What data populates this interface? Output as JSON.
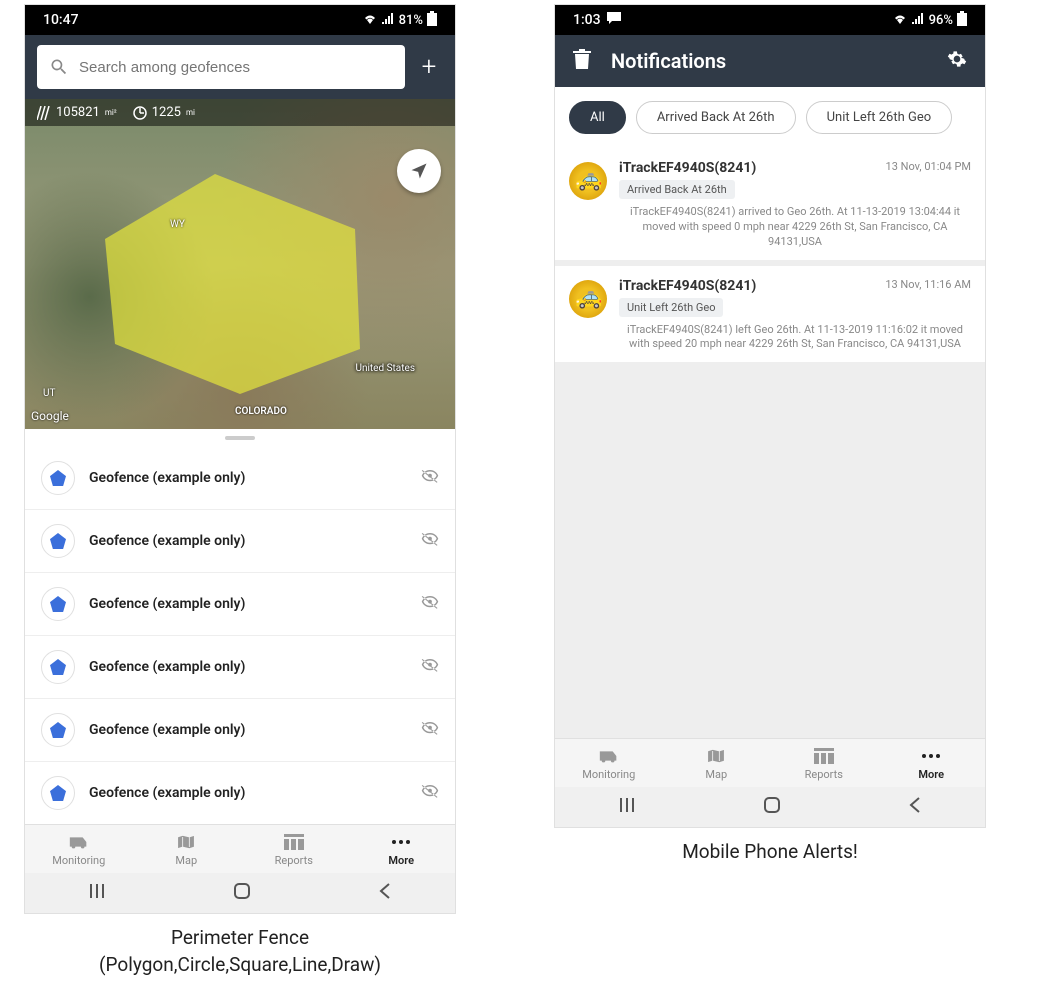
{
  "phone1": {
    "status": {
      "time": "10:47",
      "battery": "81%"
    },
    "search": {
      "placeholder": "Search among geofences"
    },
    "map": {
      "area_value": "105821",
      "area_unit": "mi²",
      "perimeter_value": "1225",
      "perimeter_unit": "mi",
      "labels": {
        "wy": "WY",
        "ut": "UT",
        "colorado": "COLORADO",
        "us": "United States"
      },
      "attribution": "Google"
    },
    "geofences": [
      {
        "label": "Geofence (example only)"
      },
      {
        "label": "Geofence (example only)"
      },
      {
        "label": "Geofence (example only)"
      },
      {
        "label": "Geofence (example only)"
      },
      {
        "label": "Geofence (example only)"
      },
      {
        "label": "Geofence (example only)"
      }
    ],
    "nav": {
      "monitoring": "Monitoring",
      "map": "Map",
      "reports": "Reports",
      "more": "More"
    },
    "caption_line1": "Perimeter Fence",
    "caption_line2": "(Polygon,Circle,Square,Line,Draw)"
  },
  "phone2": {
    "status": {
      "time": "1:03",
      "battery": "96%"
    },
    "header": {
      "title": "Notifications"
    },
    "chips": {
      "all": "All",
      "arrived": "Arrived Back At 26th",
      "left": "Unit Left 26th Geo"
    },
    "notifications": [
      {
        "device": "iTrackEF4940S(8241)",
        "time": "13 Nov, 01:04 PM",
        "badge": "Arrived Back At 26th",
        "text": "iTrackEF4940S(8241) arrived to Geo 26th.      At 11-13-2019 13:04:44 it moved with speed 0 mph near 4229 26th St, San Francisco, CA 94131,USA"
      },
      {
        "device": "iTrackEF4940S(8241)",
        "time": "13 Nov, 11:16 AM",
        "badge": "Unit Left 26th Geo",
        "text": "iTrackEF4940S(8241) left Geo 26th.      At 11-13-2019 11:16:02 it moved with speed 20 mph near 4229 26th St, San Francisco, CA 94131,USA"
      }
    ],
    "nav": {
      "monitoring": "Monitoring",
      "map": "Map",
      "reports": "Reports",
      "more": "More"
    },
    "caption": "Mobile Phone Alerts!"
  }
}
